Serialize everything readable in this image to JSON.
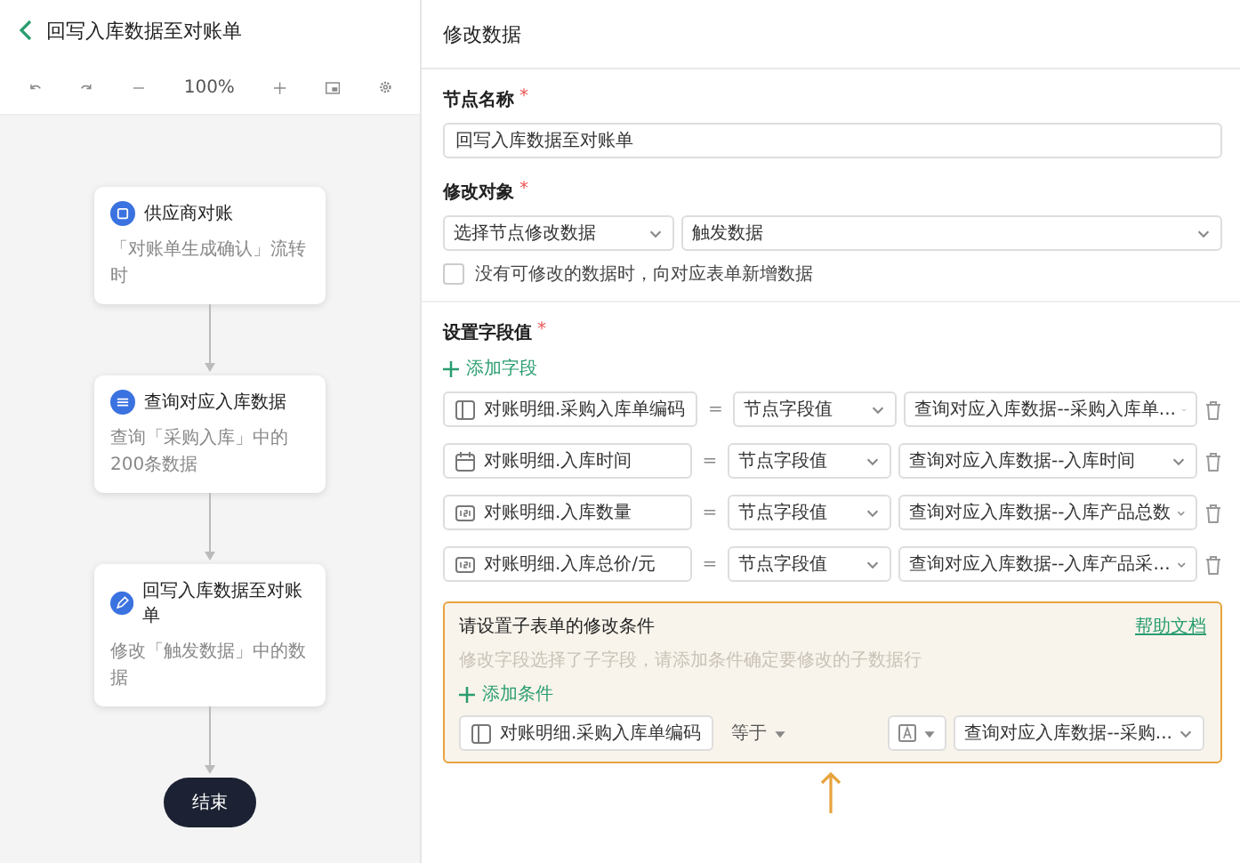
{
  "header": {
    "title": "回写入库数据至对账单"
  },
  "toolbar": {
    "zoom": "100%"
  },
  "flow": {
    "nodes": [
      {
        "kind": "trigger",
        "title": "供应商对账",
        "desc": "「对账单生成确认」流转时"
      },
      {
        "kind": "query",
        "title": "查询对应入库数据",
        "desc": "查询「采购入库」中的200条数据"
      },
      {
        "kind": "update",
        "title": "回写入库数据至对账单",
        "desc": "修改「触发数据」中的数据"
      }
    ],
    "end": "结束"
  },
  "panel": {
    "title": "修改数据",
    "node_name": {
      "label": "节点名称",
      "mark": "*",
      "value": "回写入库数据至对账单"
    },
    "target": {
      "label": "修改对象",
      "mark": "*",
      "select_1": "选择节点修改数据",
      "select_2": "触发数据"
    },
    "add_if_missing": {
      "label": "没有可修改的数据时，向对应表单新增数据",
      "checked": false
    },
    "fields": {
      "label": "设置字段值",
      "mark": "*",
      "add_label": "添加字段",
      "rows": [
        {
          "kind": "text",
          "field": "对账明细.采购入库单编码",
          "operator": "=",
          "source": "节点字段值",
          "value": "查询对应入库数据--采购入库单..."
        },
        {
          "kind": "date",
          "field": "对账明细.入库时间",
          "operator": "=",
          "source": "节点字段值",
          "value": "查询对应入库数据--入库时间"
        },
        {
          "kind": "number",
          "field": "对账明细.入库数量",
          "operator": "=",
          "source": "节点字段值",
          "value": "查询对应入库数据--入库产品总数"
        },
        {
          "kind": "number",
          "field": "对账明细.入库总价/元",
          "operator": "=",
          "source": "节点字段值",
          "value": "查询对应入库数据--入库产品采..."
        }
      ]
    },
    "condition": {
      "title": "请设置子表单的修改条件",
      "link": "帮助文档",
      "hint": "修改字段选择了子字段，请添加条件确定要修改的子数据行",
      "add_label": "添加条件",
      "row": {
        "kind": "text",
        "field": "对账明细.采购入库单编码",
        "operator": "等于",
        "value": "查询对应入库数据--采购..."
      }
    }
  }
}
